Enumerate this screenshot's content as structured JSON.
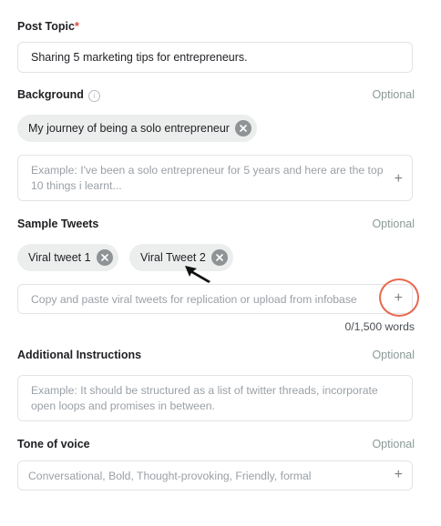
{
  "post_topic": {
    "label": "Post Topic",
    "required_mark": "*",
    "value": "Sharing 5 marketing tips for entrepreneurs."
  },
  "background": {
    "label": "Background",
    "optional": "Optional",
    "chips": [
      "My journey of being a solo entrepreneur"
    ],
    "placeholder": "Example: I've been a solo entrepreneur for 5 years and here are the top 10 things i learnt..."
  },
  "sample_tweets": {
    "label": "Sample Tweets",
    "optional": "Optional",
    "chips": [
      "Viral tweet 1",
      "Viral Tweet 2"
    ],
    "placeholder": "Copy and paste viral tweets for replication or upload from infobase",
    "word_count": "0/1,500 words"
  },
  "additional_instructions": {
    "label": "Additional Instructions",
    "optional": "Optional",
    "placeholder": "Example: It should be structured as a list of twitter threads, incorporate open loops and promises in between."
  },
  "tone_of_voice": {
    "label": "Tone of voice",
    "optional": "Optional",
    "placeholder": "Conversational, Bold, Thought-provoking, Friendly, formal"
  },
  "icons": {
    "plus": "+",
    "info": "i",
    "annotation_color": "#e8694f"
  }
}
